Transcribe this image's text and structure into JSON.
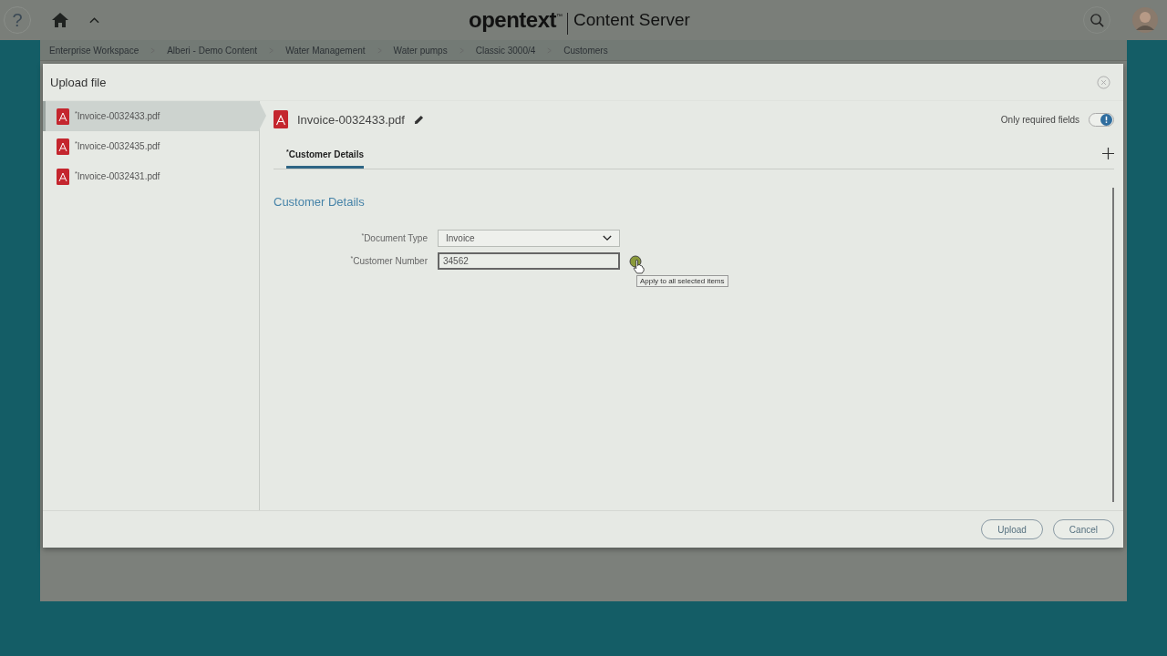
{
  "header": {
    "help": "?",
    "logo": "opentext",
    "trademark": "™",
    "product": "Content Server"
  },
  "breadcrumb": [
    "Enterprise Workspace",
    "Alberi - Demo Content",
    "Water Management",
    "Water pumps",
    "Classic 3000/4",
    "Customers"
  ],
  "dialog": {
    "title": "Upload file",
    "files": [
      {
        "name": "$^{*}$Invoice-0032433.pdf",
        "selected": true
      },
      {
        "name": "$^{*}$Invoice-0032435.pdf",
        "selected": false
      },
      {
        "name": "$^{*}$Invoice-0032431.pdf",
        "selected": false
      }
    ],
    "document_title": "Invoice-0032433.pdf",
    "required_toggle": {
      "label": "Only required fields",
      "on": true
    },
    "tabs": [
      {
        "label": "$^{*}$Customer Details",
        "selected": true
      }
    ],
    "section_title": "Customer Details",
    "fields": [
      {
        "kind": "select",
        "label": "$^{*}$Document Type",
        "value": "Invoice"
      },
      {
        "kind": "text",
        "label": "$^{*}$Customer Number",
        "value": "34562"
      }
    ],
    "tooltip": "Apply to all selected items",
    "buttons": [
      "Upload",
      "Cancel"
    ]
  }
}
